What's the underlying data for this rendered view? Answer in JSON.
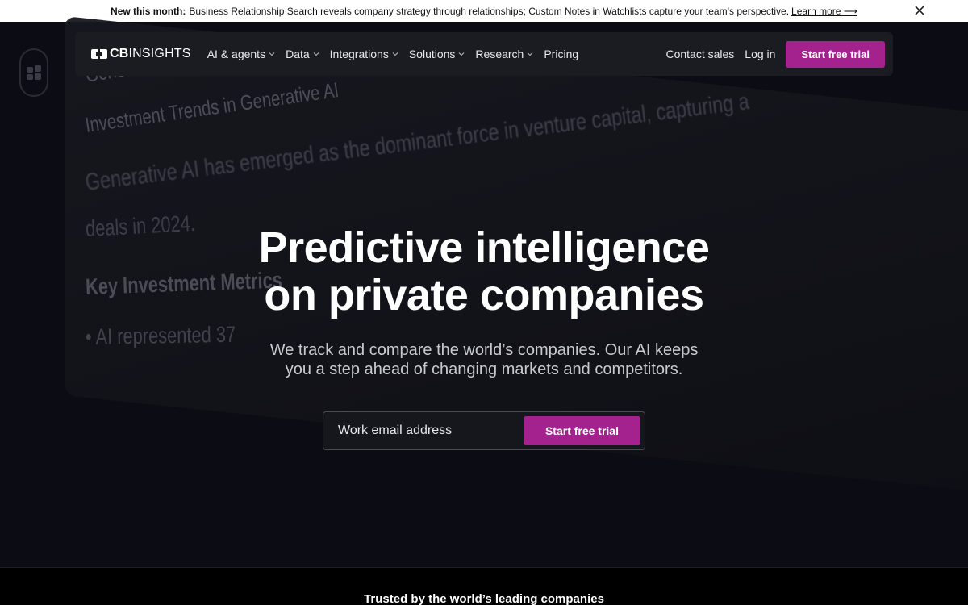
{
  "announcement": {
    "prefix": "New this month:",
    "message": "Business Relationship Search reveals company strategy through relationships; Custom Notes in Watchlists capture your team’s perspective.",
    "link_label": "Learn more ⟶"
  },
  "background_preview": {
    "line0": "Generat",
    "line1": "Investment Trends in Generative AI",
    "line2": "Generative AI has emerged as the dominant force in venture capital, capturing a",
    "line3": "deals in 2024.",
    "line4": "Key Investment Metrics",
    "line5": "• AI represented 37"
  },
  "nav": {
    "brand_bold": "CB",
    "brand_light": "INSIGHTS",
    "items": [
      {
        "label": "AI & agents"
      },
      {
        "label": "Data"
      },
      {
        "label": "Integrations"
      },
      {
        "label": "Solutions"
      },
      {
        "label": "Research"
      }
    ],
    "pricing": "Pricing",
    "contact": "Contact sales",
    "login": "Log in",
    "cta": "Start free trial"
  },
  "hero": {
    "title_line1": "Predictive intelligence",
    "title_line2": "on private companies",
    "subtitle_line1": "We track and compare the world’s companies. Our AI keeps",
    "subtitle_line2": "you a step ahead of changing markets and competitors.",
    "email_placeholder": "Work email address",
    "cta": "Start free trial"
  },
  "trusted": {
    "label": "Trusted by the world’s leading companies"
  },
  "colors": {
    "accent": "#a3228d",
    "background": "#0c0d14",
    "nav_background": "#1b1c22"
  }
}
